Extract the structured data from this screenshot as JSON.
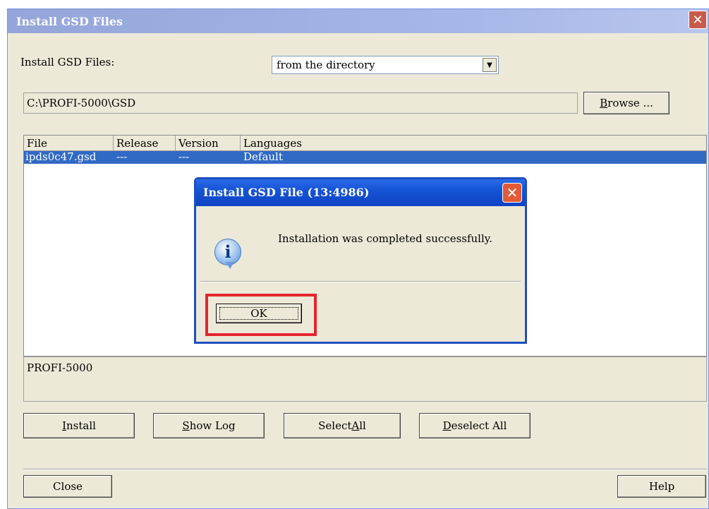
{
  "window": {
    "title": "Install GSD Files",
    "close_glyph": "✕"
  },
  "source": {
    "label": "Install GSD Files:",
    "selected": "from the directory",
    "dropdown_glyph": "▼"
  },
  "path": {
    "value": "C:\\PROFI-5000\\GSD"
  },
  "browse": {
    "pre": "",
    "accel": "B",
    "post": "rowse ..."
  },
  "table": {
    "headers": [
      "File",
      "Release",
      "Version",
      "Languages"
    ],
    "rows": [
      {
        "file": "ipds0c47.gsd",
        "release": "---",
        "version": "---",
        "languages": "Default"
      }
    ]
  },
  "description": "PROFI-5000",
  "buttons": {
    "install": {
      "pre": "",
      "accel": "I",
      "post": "nstall"
    },
    "show_log": {
      "pre": "",
      "accel": "S",
      "post": "how Log"
    },
    "select_all": {
      "pre": "Select ",
      "accel": "A",
      "post": "ll"
    },
    "deselect_all": {
      "pre": "",
      "accel": "D",
      "post": "eselect All"
    },
    "close": "Close",
    "help": "Help"
  },
  "dialog": {
    "title": "Install GSD File (13:4986)",
    "close_glyph": "✕",
    "icon_glyph": "i",
    "message": "Installation was completed successfully.",
    "ok": "OK"
  },
  "colors": {
    "highlight_box": "#e3252e",
    "selection": "#316ac5"
  }
}
